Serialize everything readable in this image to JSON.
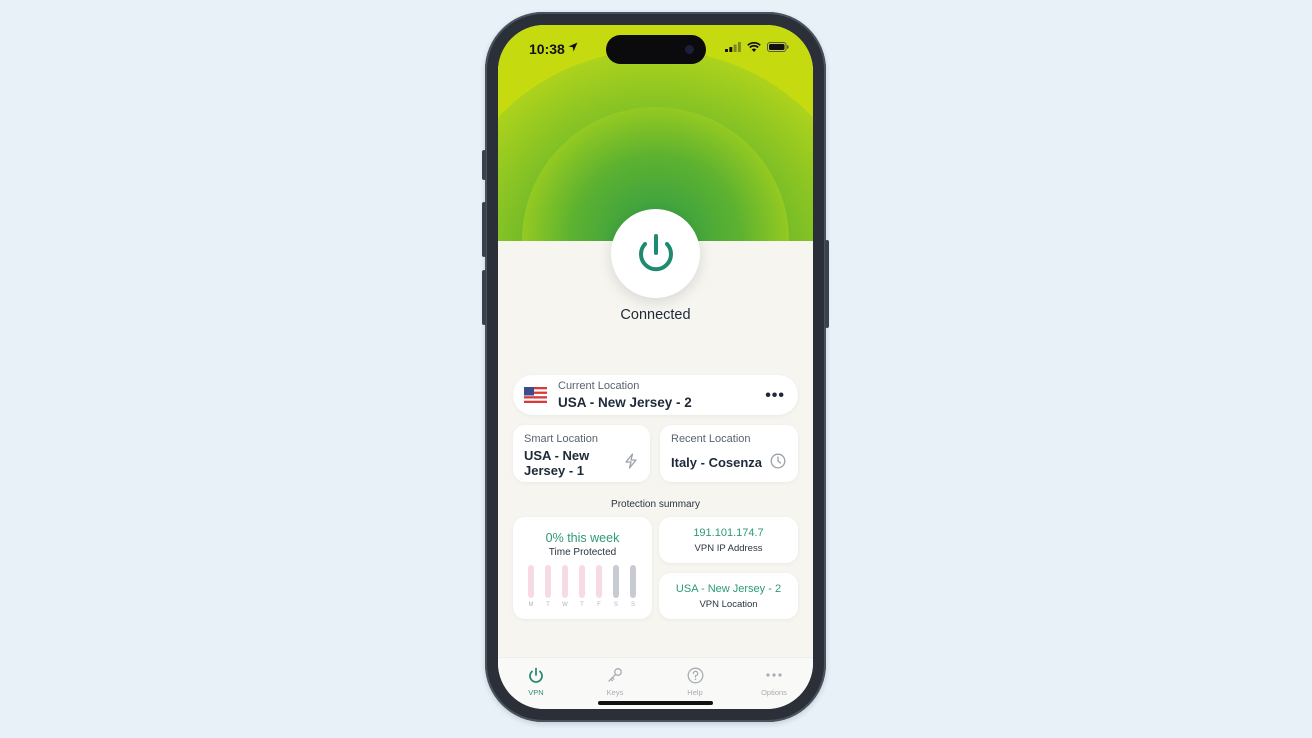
{
  "status_bar": {
    "time": "10:38"
  },
  "hero": {
    "status": "Connected"
  },
  "current_location": {
    "label": "Current Location",
    "value": "USA - New Jersey - 2",
    "more_icon": "ellipsis-icon"
  },
  "smart_location": {
    "label": "Smart Location",
    "value": "USA - New Jersey - 1",
    "icon": "bolt-icon"
  },
  "recent_location": {
    "label": "Recent Location",
    "value": "Italy - Cosenza",
    "icon": "clock-icon"
  },
  "protection": {
    "title": "Protection summary",
    "time_protected": {
      "value": "0% this week",
      "label": "Time Protected",
      "days": [
        {
          "d": "M",
          "state": "past"
        },
        {
          "d": "T",
          "state": "past"
        },
        {
          "d": "W",
          "state": "past"
        },
        {
          "d": "T",
          "state": "past"
        },
        {
          "d": "F",
          "state": "past"
        },
        {
          "d": "S",
          "state": "future"
        },
        {
          "d": "S",
          "state": "future"
        }
      ]
    },
    "ip": {
      "value": "191.101.174.7",
      "label": "VPN IP Address"
    },
    "location": {
      "value": "USA - New Jersey - 2",
      "label": "VPN Location"
    }
  },
  "tabs": [
    {
      "label": "VPN",
      "icon": "power-icon",
      "active": true
    },
    {
      "label": "Keys",
      "icon": "key-icon",
      "active": false
    },
    {
      "label": "Help",
      "icon": "help-icon",
      "active": false
    },
    {
      "label": "Options",
      "icon": "ellipsis-icon",
      "active": false
    }
  ],
  "colors": {
    "accent": "#2d8a74",
    "hero_green": "#c6da10",
    "bar_past": "#f7dbe2",
    "bar_future": "#c8ccd2"
  }
}
